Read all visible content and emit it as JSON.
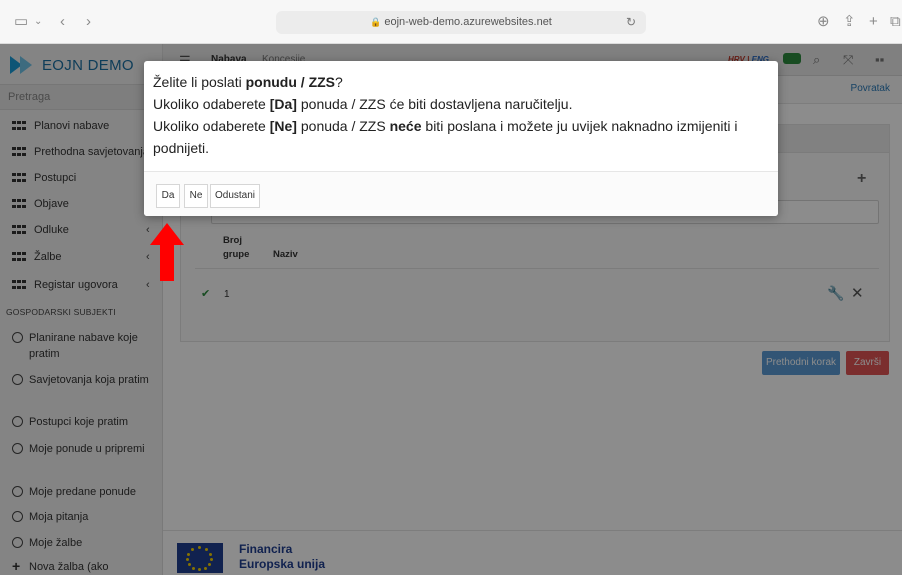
{
  "browser": {
    "url": "eojn-web-demo.azurewebsites.net"
  },
  "sidebar": {
    "logo": "EOJN DEMO",
    "search_placeholder": "Pretraga",
    "items": [
      {
        "label": "Planovi nabave"
      },
      {
        "label": "Prethodna savjetovanja"
      },
      {
        "label": "Postupci"
      },
      {
        "label": "Objave"
      },
      {
        "label": "Odluke"
      },
      {
        "label": "Žalbe"
      },
      {
        "label": "Registar ugovora"
      }
    ],
    "section": "GOSPODARSKI SUBJEKTI",
    "subject_items": [
      {
        "label": "Planirane nabave koje pratim"
      },
      {
        "label": "Savjetovanja koja pratim"
      },
      {
        "label": "Postupci koje pratim"
      },
      {
        "label": "Moje ponude u pripremi"
      },
      {
        "label": "Moje predane ponude"
      },
      {
        "label": "Moja pitanja"
      },
      {
        "label": "Moje žalbe"
      },
      {
        "label": "Nova žalba (ako"
      }
    ]
  },
  "topnav": {
    "nabava": "Nabava",
    "koncesije": "Koncesije",
    "lang_hrv": "HRV",
    "lang_sep": "|",
    "lang_eng": "ENG"
  },
  "main": {
    "back": "Povratak",
    "table": {
      "col_group": "Broj grupe",
      "col_name": "Naziv",
      "row_number": "1"
    },
    "prev_button": "Prethodni korak",
    "finish_button": "Završi"
  },
  "footer": {
    "line1": "Financira",
    "line2": "Europska unija"
  },
  "modal": {
    "q_prefix": "Želite li poslati ",
    "q_bold": "ponudu / ZZS",
    "q_suffix": "?",
    "l2_prefix": "Ukoliko odaberete ",
    "l2_bold": "[Da]",
    "l2_suffix": " ponuda / ZZS će biti dostavljena naručitelju.",
    "l3_prefix": "Ukoliko odaberete ",
    "l3_bold": "[Ne]",
    "l3_mid": " ponuda / ZZS ",
    "l3_bold2": "neće",
    "l3_suffix": " biti poslana i možete ju uvijek naknadno izmijeniti i podnijeti.",
    "buttons": {
      "yes": "Da",
      "no": "Ne",
      "cancel": "Odustani"
    }
  },
  "colors": {
    "accent": "#2a7ab8",
    "finish": "#e05555",
    "prev": "#5b9bd5",
    "arrow": "#ff0000"
  }
}
